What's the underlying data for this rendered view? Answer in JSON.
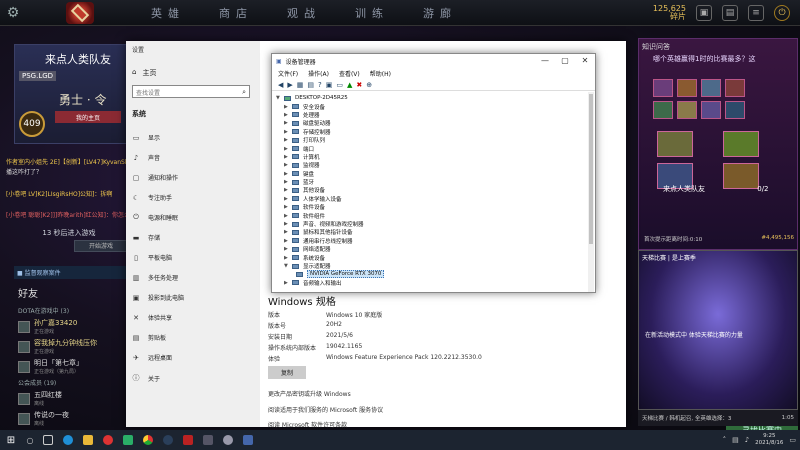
{
  "game": {
    "nav": [
      "英雄",
      "商店",
      "观战",
      "训练",
      "游廊"
    ],
    "gold_amount": "125,625",
    "gold_label": "碎片",
    "profile_name": "来点人类队友",
    "profile_tag": "PSG.LGD",
    "rank": "勇士 · 令",
    "level": "409",
    "profile_button": "我的主页",
    "chat": [
      {
        "text": "作者室内小姐先 2E]【创新】[LV47]KyvanShrike]：但是他说字已经不能构成最",
        "color": "#f2c94c"
      },
      {
        "text": "播这咋打了？",
        "color": "#ddd"
      },
      {
        "text": "[小卷吧 LV]K2]LIsgiRsHO]公知]：拆啊",
        "color": "#f2c94c"
      },
      {
        "text": "[小卷吧 聪聪]K2]]]昨晚arith]红公知]：你怎么出那个东西了",
        "color": "#e06060"
      }
    ],
    "queue_text": "13 秒后进入游戏",
    "play_button": "开始游戏",
    "friends_header": "■ 监督观察案件",
    "friends_title": "好友",
    "friends_online": "DOTA在游戏中 (3)",
    "friends": [
      {
        "name": "孙广嘉33420",
        "status": "正在游戏"
      },
      {
        "name": "容我掉九分钟线压你",
        "status": "正在游戏"
      },
      {
        "name": "明日「第七章」",
        "status": "正在游戏（第九局）"
      }
    ],
    "friends_group": "公会成员 (19)",
    "friends2": [
      {
        "name": "五四红楼",
        "status": "离线"
      },
      {
        "name": "传说の一夜",
        "status": "离线"
      }
    ],
    "right_header": "知识问答",
    "question": "哪个英雄赢得1时的比赛最多？这",
    "team_label": "来点人类队友",
    "team_score": "0/2",
    "answer_time": "首次提示距离时间:0:10",
    "reward": "#4,495,156",
    "promo_title": "天梯比赛 | 是上赛季",
    "promo_text": "在新活动模式中 体验天梯比赛的力量",
    "status_text": "天梯比赛 / 韩机起召, 全英雄选择：3",
    "status_time": "1:05",
    "find_match": "寻找比赛中"
  },
  "settings": {
    "window_title": "设置",
    "home": "主页",
    "search_placeholder": "查找设置",
    "section": "系统",
    "items": [
      "显示",
      "声音",
      "通知和操作",
      "专注助手",
      "电源和睡眠",
      "存储",
      "平板电脑",
      "多任务处理",
      "投影到此电脑",
      "体验共享",
      "剪贴板",
      "远程桌面",
      "关于"
    ],
    "spec_title": "Windows 规格",
    "specs": [
      {
        "k": "版本",
        "v": "Windows 10 家庭版"
      },
      {
        "k": "版本号",
        "v": "20H2"
      },
      {
        "k": "安装日期",
        "v": "2021/5/6"
      },
      {
        "k": "操作系统内部版本",
        "v": "19042.1165"
      },
      {
        "k": "体验",
        "v": "Windows Feature Experience Pack 120.2212.3530.0"
      }
    ],
    "copy_button": "复制",
    "links": [
      "更改产品密钥或升级 Windows",
      "阅读适用于我们服务的 Microsoft 服务协议",
      "阅读 Microsoft 软件许可条款"
    ]
  },
  "device_manager": {
    "title": "设备管理器",
    "menu": [
      "文件(F)",
      "操作(A)",
      "查看(V)",
      "帮助(H)"
    ],
    "root": "DESKTOP-2D45R25",
    "nodes": [
      "安全设备",
      "处理器",
      "磁盘驱动器",
      "存储控制器",
      "打印队列",
      "端口",
      "计算机",
      "监视器",
      "键盘",
      "蓝牙",
      "其他设备",
      "人体学输入设备",
      "软件设备",
      "软件组件",
      "声音、视频和游戏控制器",
      "鼠标和其他指针设备",
      "通用串行总线控制器",
      "网络适配器",
      "系统设备",
      "显示适配器"
    ],
    "gpu": "NVIDIA GeForce RTX 3070",
    "last": "音频输入和输出"
  },
  "taskbar": {
    "time": "9:25",
    "date": "2021/8/16"
  }
}
